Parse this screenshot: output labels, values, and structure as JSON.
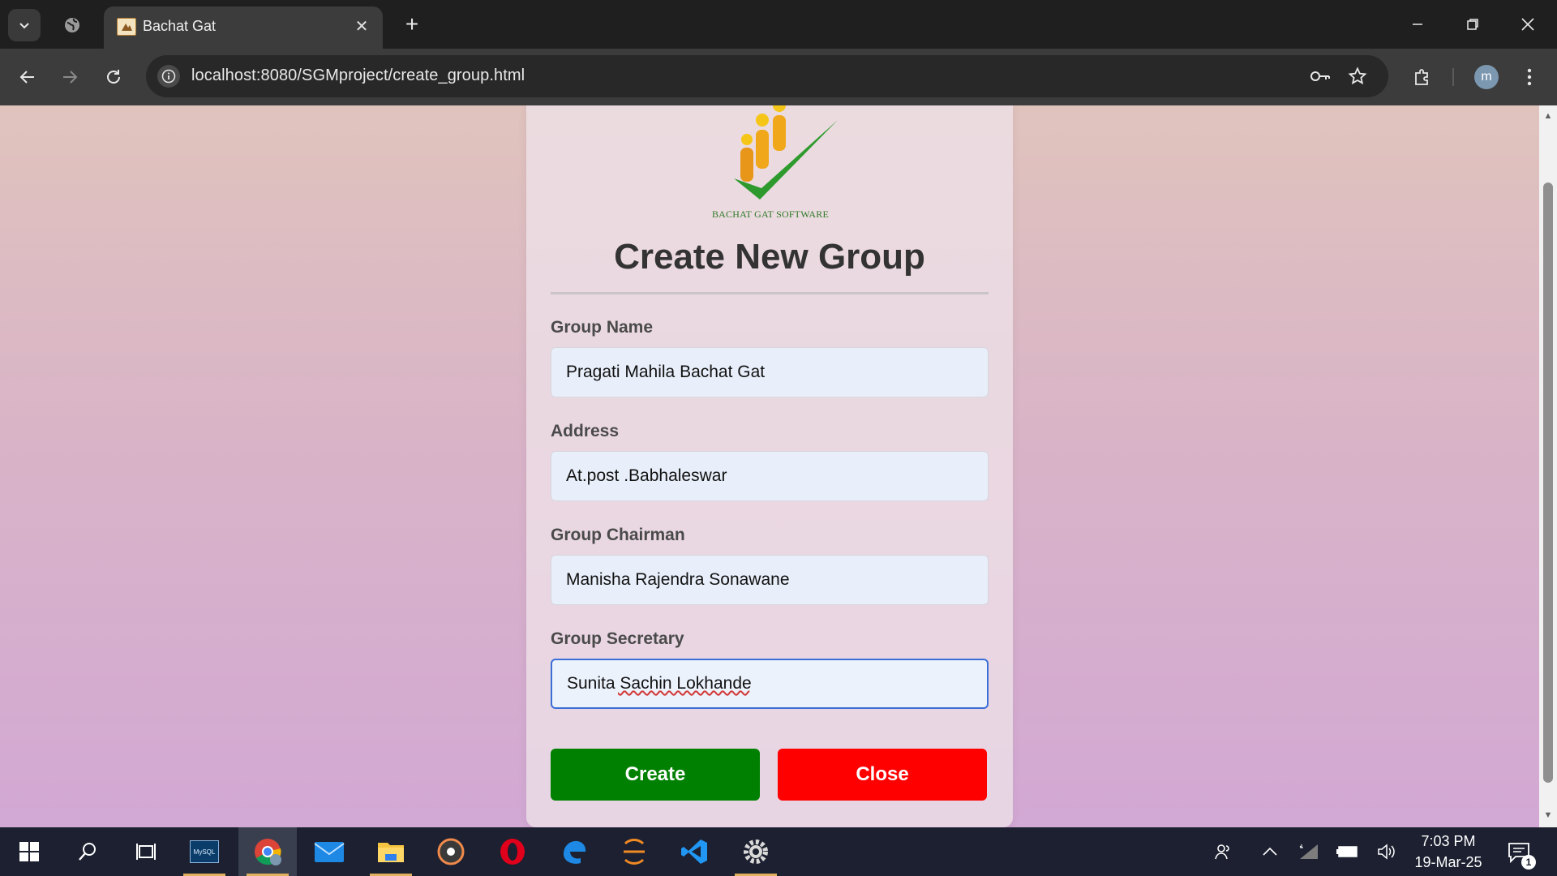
{
  "browser": {
    "tab": {
      "title": "Bachat Gat"
    },
    "address_bar": {
      "url": "localhost:8080/SGMproject/create_group.html"
    },
    "profile_initial": "m"
  },
  "page": {
    "logo_text": "BACHAT GAT SOFTWARE",
    "title": "Create New Group",
    "fields": {
      "group_name": {
        "label": "Group Name",
        "value": "Pragati Mahila Bachat Gat"
      },
      "address": {
        "label": "Address",
        "value": "At.post .Babhaleswar"
      },
      "chairman": {
        "label": "Group Chairman",
        "value": "Manisha Rajendra Sonawane"
      },
      "secretary": {
        "label": "Group Secretary",
        "value": "Sunita Sachin Lokhande"
      }
    },
    "buttons": {
      "create": "Create",
      "close": "Close"
    },
    "colors": {
      "create": "#008000",
      "close": "#ff0000",
      "logo_green": "#2e9a2e",
      "logo_yellow": "#f5c518"
    }
  },
  "taskbar": {
    "mysql_label": "MySQL",
    "clock": {
      "time": "7:03 PM",
      "date": "19-Mar-25"
    },
    "notification_count": "1"
  }
}
